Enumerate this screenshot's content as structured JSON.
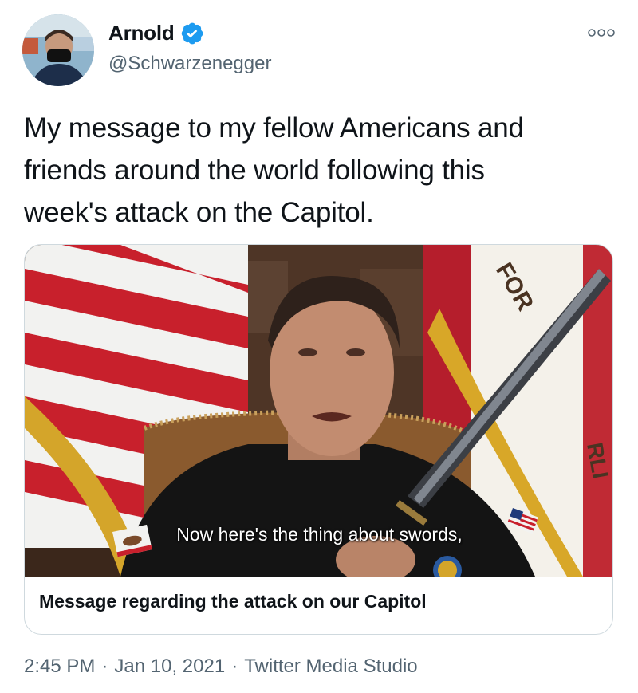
{
  "author": {
    "display_name": "Arnold",
    "handle": "@Schwarzenegger",
    "verified": true,
    "verified_color": "#1d9bf0"
  },
  "icons": {
    "more": "more-options-icon",
    "verified": "verified-badge-icon"
  },
  "tweet": {
    "text_lines": [
      "My message to my fellow Americans and",
      "friends around the world following this",
      "week's attack on the Capitol."
    ]
  },
  "media": {
    "caption": "Now here's the thing about swords,",
    "title": "Message regarding the attack on our Capitol"
  },
  "footer": {
    "time": "2:45 PM",
    "date": "Jan 10, 2021",
    "separator": "·",
    "source": "Twitter Media Studio"
  },
  "colors": {
    "text": "#0f1419",
    "secondary": "#536471",
    "border": "#cfd9de"
  }
}
